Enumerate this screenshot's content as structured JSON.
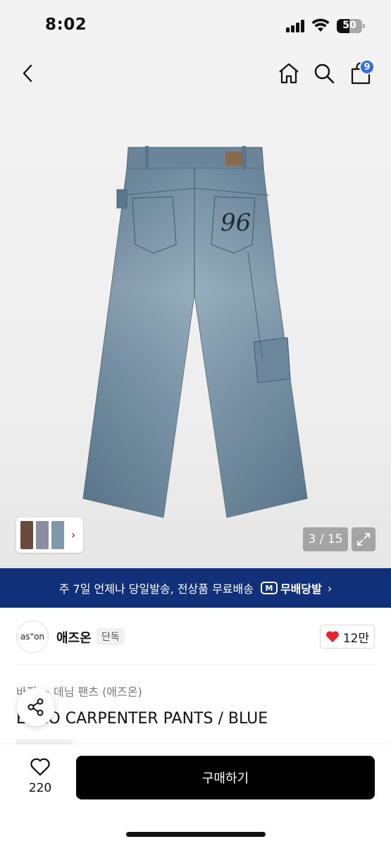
{
  "status_bar": {
    "time": "8:02",
    "battery": "50",
    "battery_level": 0.5
  },
  "header": {
    "icons": [
      "back-arrow-icon",
      "home-icon",
      "search-icon",
      "shopping-bag-icon"
    ],
    "cart_badge": "9"
  },
  "gallery": {
    "counter": "3 / 15",
    "thumbnail_more": "›"
  },
  "banner": {
    "text": "주 7일 언제나 당일발송, 전상품 무료배송",
    "logo": "M",
    "badge": "무배당발",
    "chevron": "›"
  },
  "brand": {
    "logo_text": "as\"on",
    "name": "애즈온",
    "tag": "단독",
    "likes": "12만"
  },
  "product": {
    "category": "바지 > 데님 팬츠 (애즈온)",
    "title": "ENZO CARPENTER PANTS / BLUE"
  },
  "bottom_bar": {
    "wish_count": "220",
    "buy_label": "구매하기"
  },
  "colors": {
    "banner_bg": "#10307a",
    "badge_blue": "#2f6de6",
    "heart_red": "#e8232f",
    "buy_bg": "#000000"
  }
}
